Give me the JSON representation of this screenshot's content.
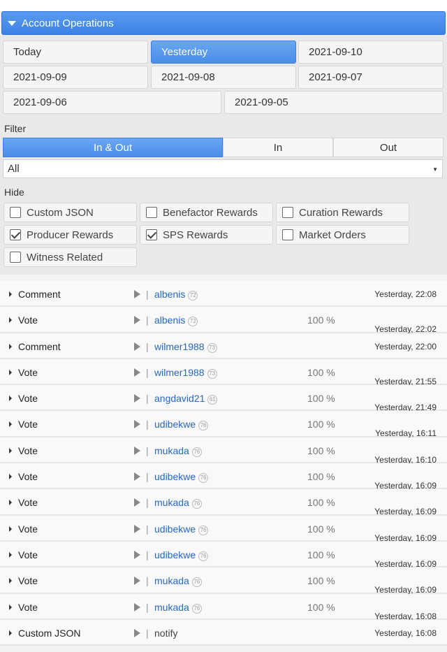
{
  "header": {
    "title": "Account Operations"
  },
  "dates": [
    {
      "label": "Today",
      "active": false
    },
    {
      "label": "Yesterday",
      "active": true
    },
    {
      "label": "2021-09-10",
      "active": false
    },
    {
      "label": "2021-09-09",
      "active": false
    },
    {
      "label": "2021-09-08",
      "active": false
    },
    {
      "label": "2021-09-07",
      "active": false
    },
    {
      "label": "2021-09-06",
      "active": false
    },
    {
      "label": "2021-09-05",
      "active": false
    }
  ],
  "filter": {
    "label": "Filter",
    "segments": [
      {
        "label": "In & Out",
        "active": true
      },
      {
        "label": "In",
        "active": false
      },
      {
        "label": "Out",
        "active": false
      }
    ],
    "select_value": "All"
  },
  "hide": {
    "label": "Hide",
    "options": [
      {
        "label": "Custom JSON",
        "checked": false
      },
      {
        "label": "Benefactor Rewards",
        "checked": false
      },
      {
        "label": "Curation Rewards",
        "checked": false
      },
      {
        "label": "Producer Rewards",
        "checked": true
      },
      {
        "label": "SPS Rewards",
        "checked": true
      },
      {
        "label": "Market Orders",
        "checked": false
      },
      {
        "label": "Witness Related",
        "checked": false
      }
    ]
  },
  "operations": [
    {
      "type": "Comment",
      "user": "albenis",
      "rep": "72",
      "pct": "",
      "time": "Yesterday, 22:08",
      "plain": ""
    },
    {
      "type": "Vote",
      "user": "albenis",
      "rep": "72",
      "pct": "100 %",
      "time": "Yesterday, 22:02",
      "plain": ""
    },
    {
      "type": "Comment",
      "user": "wilmer1988",
      "rep": "73",
      "pct": "",
      "time": "Yesterday, 22:00",
      "plain": ""
    },
    {
      "type": "Vote",
      "user": "wilmer1988",
      "rep": "73",
      "pct": "100 %",
      "time": "Yesterday, 21:55",
      "plain": ""
    },
    {
      "type": "Vote",
      "user": "angdavid21",
      "rep": "61",
      "pct": "100 %",
      "time": "Yesterday, 21:49",
      "plain": ""
    },
    {
      "type": "Vote",
      "user": "udibekwe",
      "rep": "76",
      "pct": "100 %",
      "time": "Yesterday, 16:11",
      "plain": ""
    },
    {
      "type": "Vote",
      "user": "mukada",
      "rep": "76",
      "pct": "100 %",
      "time": "Yesterday, 16:10",
      "plain": ""
    },
    {
      "type": "Vote",
      "user": "udibekwe",
      "rep": "76",
      "pct": "100 %",
      "time": "Yesterday, 16:09",
      "plain": ""
    },
    {
      "type": "Vote",
      "user": "mukada",
      "rep": "76",
      "pct": "100 %",
      "time": "Yesterday, 16:09",
      "plain": ""
    },
    {
      "type": "Vote",
      "user": "udibekwe",
      "rep": "76",
      "pct": "100 %",
      "time": "Yesterday, 16:09",
      "plain": ""
    },
    {
      "type": "Vote",
      "user": "udibekwe",
      "rep": "76",
      "pct": "100 %",
      "time": "Yesterday, 16:09",
      "plain": ""
    },
    {
      "type": "Vote",
      "user": "mukada",
      "rep": "76",
      "pct": "100 %",
      "time": "Yesterday, 16:09",
      "plain": ""
    },
    {
      "type": "Vote",
      "user": "mukada",
      "rep": "76",
      "pct": "100 %",
      "time": "Yesterday, 16:08",
      "plain": ""
    },
    {
      "type": "Custom JSON",
      "user": "",
      "rep": "",
      "pct": "",
      "time": "Yesterday, 16:08",
      "plain": "notify"
    }
  ]
}
